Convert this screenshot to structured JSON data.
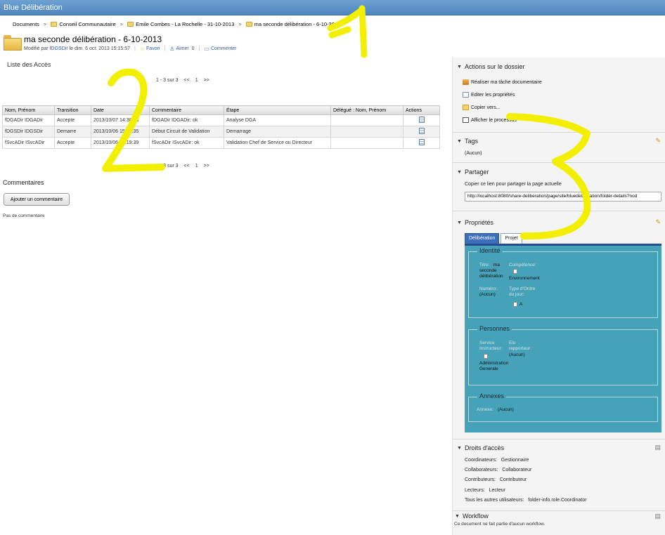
{
  "header": {
    "title": "Blue Délibération"
  },
  "breadcrumb": {
    "items": [
      "Documents",
      "Conseil Communautaire",
      "Emile Combes - La Rochelle - 31-10-2013",
      "ma seconde délibération - 6-10-2013"
    ],
    "separator": ">"
  },
  "document": {
    "title": "ma seconde délibération - 6-10-2013",
    "modified_prefix": "Modifié par",
    "modified_by": "fDGSDir",
    "modified_on": "le dim. 6 oct. 2013 15:15:57",
    "favorite_label": "Favori",
    "like_label": "Aimer",
    "like_count": "0",
    "comment_label": "Commenter"
  },
  "access_list": {
    "title": "Liste des Accès",
    "pager": {
      "range": "1 - 3 sur 3",
      "first": "<<",
      "page": "1",
      "next": ">>"
    },
    "columns": [
      "Nom, Prénom",
      "Transition",
      "Date",
      "Commentaire",
      "Étape",
      "Délégué : Nom, Prénom",
      "Actions"
    ],
    "rows": [
      [
        "fDGADir IDGADir",
        "Accepte",
        "2013/10/07 14:38:28",
        "fDGADir IDGADir: ok",
        "Analyse DGA",
        ""
      ],
      [
        "fDGSDir IDGSDir",
        "Demarre",
        "2013/10/06 15:15:35",
        "Début Circuit de Validation",
        "Demarrage",
        ""
      ],
      [
        "fSvcADir ISvcADir",
        "Accepte",
        "2013/10/06 18:19:39",
        "fSvcADir ISvcADir: ok",
        "Validation Chef de Service ou Directeur",
        ""
      ]
    ]
  },
  "comments": {
    "title": "Commentaires",
    "add_button": "Ajouter un commentaire",
    "empty_text": "Pas de commentaire"
  },
  "sidebar": {
    "actions": {
      "title": "Actions sur le dossier",
      "items": [
        "Réaliser ma tâche documentaire",
        "Editer les propriétés",
        "Copier vers...",
        "Afficher le processus"
      ]
    },
    "tags": {
      "title": "Tags",
      "value": "(Aucun)"
    },
    "share": {
      "title": "Partager",
      "instruction": "Copier ce lien pour partager la page actuelle",
      "url": "http://localhost:8080/share-deliberation/page/site/bluedeliberation/folder-details?nod"
    },
    "properties": {
      "title": "Propriétés",
      "tabs": [
        "Délibération",
        "Projet"
      ],
      "identite": {
        "legend": "Identité",
        "titre_label": "Titre:",
        "titre_value": "ma seconde délibération",
        "competence_label": "Compétence:",
        "competence_value": "Environnement",
        "numero_label": "Numéro:",
        "numero_value": "(Aucun)",
        "type_label": "Type d'Ordre du jour:",
        "type_value": "A"
      },
      "personnes": {
        "legend": "Personnes",
        "service_label": "Service Instructeur:",
        "service_value": "Administration Generale",
        "elu_label": "Elu rapporteur:",
        "elu_value": "(Aucun)"
      },
      "annexes": {
        "legend": "Annexes",
        "label": "Annexe:",
        "value": "(Aucun)"
      }
    },
    "rights": {
      "title": "Droits d'accès",
      "items": [
        {
          "label": "Coordinateurs:",
          "value": "Gestionnaire"
        },
        {
          "label": "Collaborateurs:",
          "value": "Collaborateur"
        },
        {
          "label": "Contributeurs:",
          "value": "Contributeur"
        },
        {
          "label": "Lecteurs:",
          "value": "Lecteur"
        },
        {
          "label": "Tous les autres utilisateurs:",
          "value": "folder-info.role.Coordinator"
        }
      ]
    },
    "workflow": {
      "title": "Workflow",
      "text": "Ce document ne fait partie d'aucun workflow."
    }
  },
  "annotations": {
    "color": "#f2f000",
    "marks": [
      "1",
      "2",
      "3"
    ]
  }
}
